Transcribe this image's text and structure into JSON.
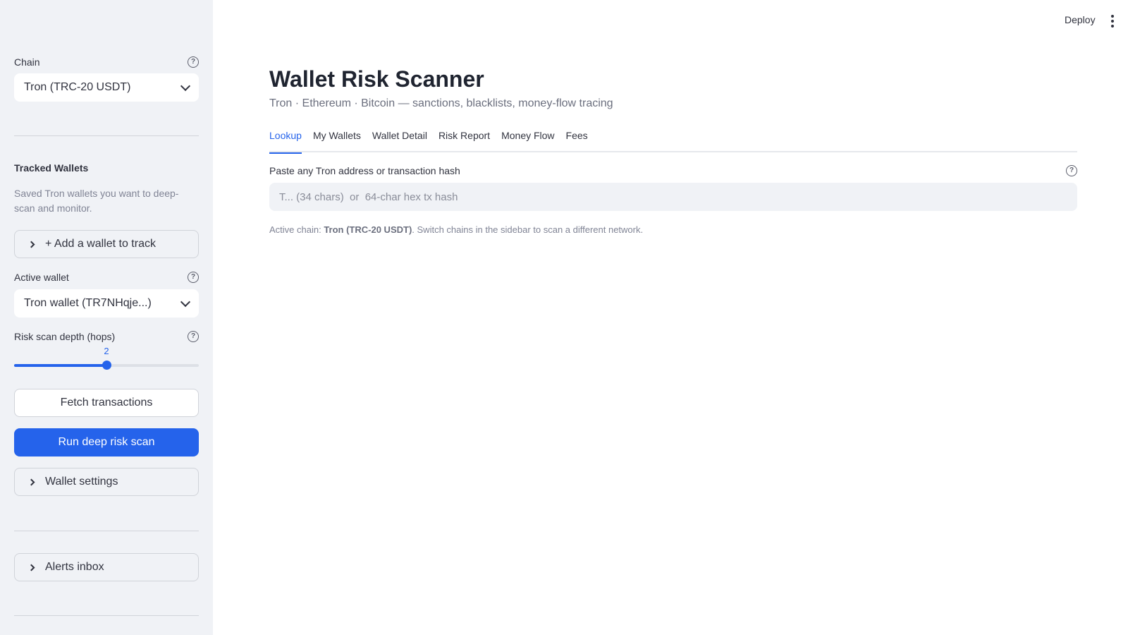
{
  "sidebar": {
    "chain": {
      "label": "Chain",
      "selected": "Tron (TRC-20 USDT)"
    },
    "tracked": {
      "heading": "Tracked Wallets",
      "caption": "Saved Tron wallets you want to deep-scan and monitor.",
      "add_label": "+ Add a wallet to track"
    },
    "active_wallet": {
      "label": "Active wallet",
      "selected": "Tron wallet (TR7NHqje...)"
    },
    "depth": {
      "label": "Risk scan depth (hops)",
      "value": "2",
      "fraction": 0.5
    },
    "fetch_label": "Fetch transactions",
    "scan_label": "Run deep risk scan",
    "settings_label": "Wallet settings",
    "alerts_label": "Alerts inbox"
  },
  "header": {
    "deploy_label": "Deploy"
  },
  "main": {
    "title": "Wallet Risk Scanner",
    "subtitle": "Tron · Ethereum · Bitcoin — sanctions, blacklists, money-flow tracing",
    "tabs": [
      {
        "label": "Lookup"
      },
      {
        "label": "My Wallets"
      },
      {
        "label": "Wallet Detail"
      },
      {
        "label": "Risk Report"
      },
      {
        "label": "Money Flow"
      },
      {
        "label": "Fees"
      }
    ],
    "lookup": {
      "label": "Paste any Tron address or transaction hash",
      "placeholder": "T... (34 chars)  or  64-char hex tx hash",
      "caption_prefix": "Active chain: ",
      "caption_chain": "Tron (TRC-20 USDT)",
      "caption_suffix": ". Switch chains in the sidebar to scan a different network."
    }
  },
  "colors": {
    "accent": "#2563eb",
    "sidebar_bg": "#f0f2f6"
  }
}
